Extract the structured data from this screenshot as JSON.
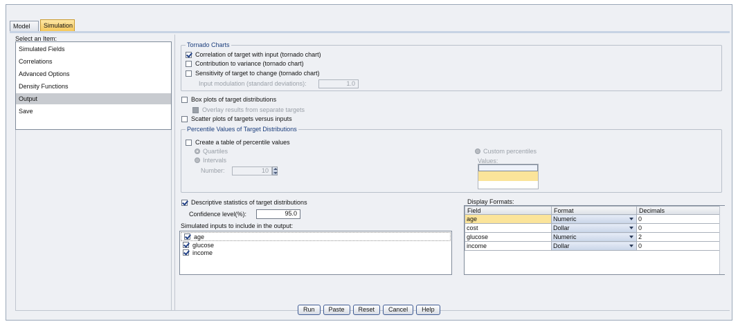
{
  "tabs": [
    {
      "label": "Model"
    },
    {
      "label": "Simulation",
      "active": true
    }
  ],
  "left": {
    "title": "Select an Item:",
    "items": [
      {
        "label": "Simulated Fields"
      },
      {
        "label": "Correlations"
      },
      {
        "label": "Advanced Options"
      },
      {
        "label": "Density Functions"
      },
      {
        "label": "Output",
        "selected": true
      },
      {
        "label": "Save"
      }
    ]
  },
  "tornado": {
    "legend": "Tornado Charts",
    "correlation": "Correlation of target with input (tornado chart)",
    "contribution": "Contribution to variance (tornado chart)",
    "sensitivity": "Sensitivity of target to change (tornado chart)",
    "modulation_label": "Input modulation (standard deviations):",
    "modulation_value": "1.0"
  },
  "boxplots": {
    "label": "Box plots of target distributions",
    "overlay": "Overlay results from separate targets"
  },
  "scatter": {
    "label": "Scatter plots of targets versus inputs"
  },
  "percentile": {
    "legend": "Percentile Values of Target Distributions",
    "create_table": "Create a table of percentile values",
    "quartiles": "Quartiles",
    "intervals": "Intervals",
    "number_label": "Number:",
    "number_value": "10",
    "custom": "Custom percentiles",
    "values_label": "Values:"
  },
  "descriptive": {
    "label": "Descriptive statistics of target distributions",
    "confidence_label": "Confidence level(%):",
    "confidence_value": "95.0"
  },
  "inputs": {
    "label": "Simulated inputs to include in the output:",
    "items": [
      {
        "label": "age",
        "checked": true
      },
      {
        "label": "glucose",
        "checked": true
      },
      {
        "label": "income",
        "checked": true
      }
    ]
  },
  "formats": {
    "label": "Display Formats:",
    "columns": [
      "Field",
      "Format",
      "Decimals"
    ],
    "rows": [
      {
        "field": "age",
        "format": "Numeric",
        "decimals": "0"
      },
      {
        "field": "cost",
        "format": "Dollar",
        "decimals": "0"
      },
      {
        "field": "glucose",
        "format": "Numeric",
        "decimals": "2"
      },
      {
        "field": "income",
        "format": "Dollar",
        "decimals": "0"
      }
    ]
  },
  "buttons": {
    "run": "Run",
    "paste": "Paste",
    "reset": "Reset",
    "cancel": "Cancel",
    "help": "Help"
  },
  "colors": {
    "active_tab": "#f6c85a",
    "selected_field": "#fbe49a",
    "check": "#1f3f86"
  }
}
